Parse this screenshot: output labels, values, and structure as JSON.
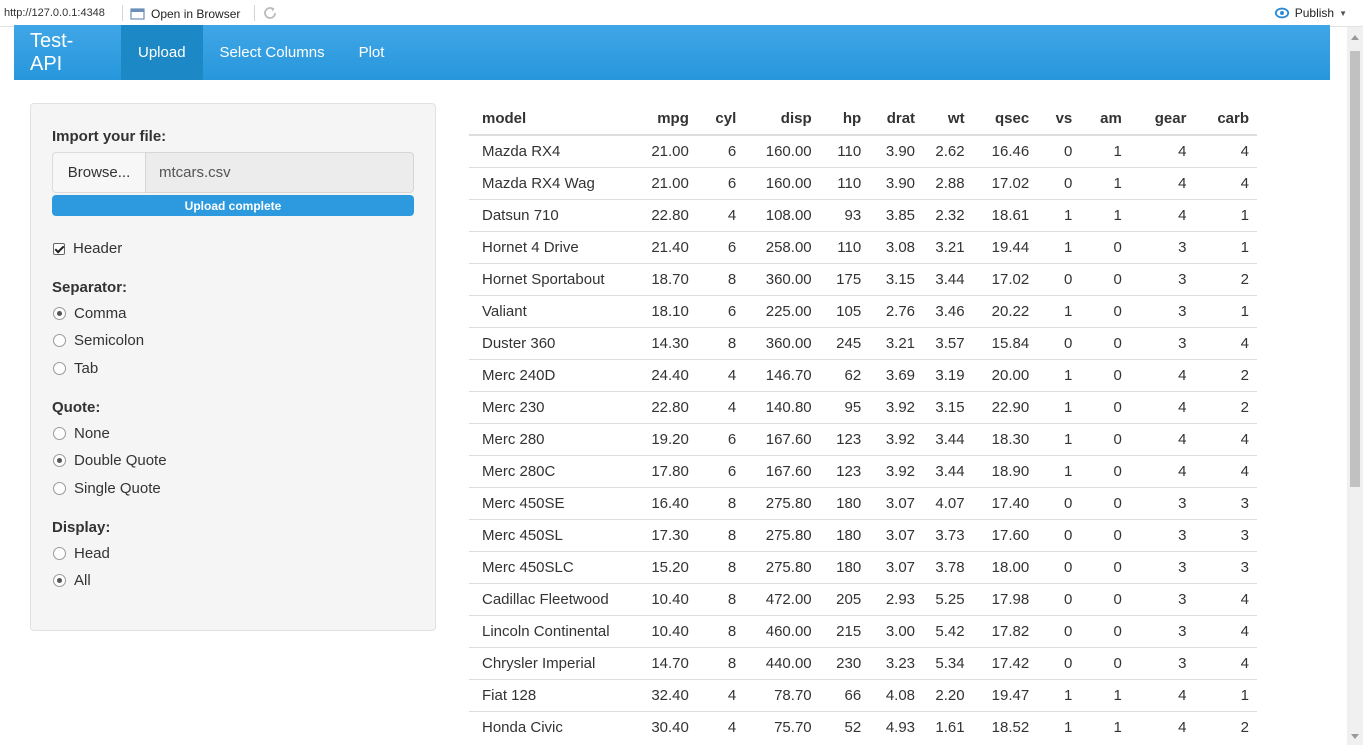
{
  "viewer": {
    "url": "http://127.0.0.1:4348",
    "open_in_browser": "Open in Browser",
    "publish": "Publish"
  },
  "navbar": {
    "brand": "Test-API",
    "tabs": [
      {
        "label": "Upload",
        "active": true
      },
      {
        "label": "Select Columns",
        "active": false
      },
      {
        "label": "Plot",
        "active": false
      }
    ]
  },
  "sidebar": {
    "import_label": "Import your file:",
    "browse_label": "Browse...",
    "file_name": "mtcars.csv",
    "progress_text": "Upload complete",
    "progress": 1.0,
    "header_label": "Header",
    "header_checked": true,
    "separator_label": "Separator:",
    "separator_options": [
      "Comma",
      "Semicolon",
      "Tab"
    ],
    "separator_selected": "Comma",
    "quote_label": "Quote:",
    "quote_options": [
      "None",
      "Double Quote",
      "Single Quote"
    ],
    "quote_selected": "Double Quote",
    "display_label": "Display:",
    "display_options": [
      "Head",
      "All"
    ],
    "display_selected": "All"
  },
  "table": {
    "columns": [
      "model",
      "mpg",
      "cyl",
      "disp",
      "hp",
      "drat",
      "wt",
      "qsec",
      "vs",
      "am",
      "gear",
      "carb"
    ],
    "rows": [
      [
        "Mazda RX4",
        "21.00",
        "6",
        "160.00",
        "110",
        "3.90",
        "2.62",
        "16.46",
        "0",
        "1",
        "4",
        "4"
      ],
      [
        "Mazda RX4 Wag",
        "21.00",
        "6",
        "160.00",
        "110",
        "3.90",
        "2.88",
        "17.02",
        "0",
        "1",
        "4",
        "4"
      ],
      [
        "Datsun 710",
        "22.80",
        "4",
        "108.00",
        "93",
        "3.85",
        "2.32",
        "18.61",
        "1",
        "1",
        "4",
        "1"
      ],
      [
        "Hornet 4 Drive",
        "21.40",
        "6",
        "258.00",
        "110",
        "3.08",
        "3.21",
        "19.44",
        "1",
        "0",
        "3",
        "1"
      ],
      [
        "Hornet Sportabout",
        "18.70",
        "8",
        "360.00",
        "175",
        "3.15",
        "3.44",
        "17.02",
        "0",
        "0",
        "3",
        "2"
      ],
      [
        "Valiant",
        "18.10",
        "6",
        "225.00",
        "105",
        "2.76",
        "3.46",
        "20.22",
        "1",
        "0",
        "3",
        "1"
      ],
      [
        "Duster 360",
        "14.30",
        "8",
        "360.00",
        "245",
        "3.21",
        "3.57",
        "15.84",
        "0",
        "0",
        "3",
        "4"
      ],
      [
        "Merc 240D",
        "24.40",
        "4",
        "146.70",
        "62",
        "3.69",
        "3.19",
        "20.00",
        "1",
        "0",
        "4",
        "2"
      ],
      [
        "Merc 230",
        "22.80",
        "4",
        "140.80",
        "95",
        "3.92",
        "3.15",
        "22.90",
        "1",
        "0",
        "4",
        "2"
      ],
      [
        "Merc 280",
        "19.20",
        "6",
        "167.60",
        "123",
        "3.92",
        "3.44",
        "18.30",
        "1",
        "0",
        "4",
        "4"
      ],
      [
        "Merc 280C",
        "17.80",
        "6",
        "167.60",
        "123",
        "3.92",
        "3.44",
        "18.90",
        "1",
        "0",
        "4",
        "4"
      ],
      [
        "Merc 450SE",
        "16.40",
        "8",
        "275.80",
        "180",
        "3.07",
        "4.07",
        "17.40",
        "0",
        "0",
        "3",
        "3"
      ],
      [
        "Merc 450SL",
        "17.30",
        "8",
        "275.80",
        "180",
        "3.07",
        "3.73",
        "17.60",
        "0",
        "0",
        "3",
        "3"
      ],
      [
        "Merc 450SLC",
        "15.20",
        "8",
        "275.80",
        "180",
        "3.07",
        "3.78",
        "18.00",
        "0",
        "0",
        "3",
        "3"
      ],
      [
        "Cadillac Fleetwood",
        "10.40",
        "8",
        "472.00",
        "205",
        "2.93",
        "5.25",
        "17.98",
        "0",
        "0",
        "3",
        "4"
      ],
      [
        "Lincoln Continental",
        "10.40",
        "8",
        "460.00",
        "215",
        "3.00",
        "5.42",
        "17.82",
        "0",
        "0",
        "3",
        "4"
      ],
      [
        "Chrysler Imperial",
        "14.70",
        "8",
        "440.00",
        "230",
        "3.23",
        "5.34",
        "17.42",
        "0",
        "0",
        "3",
        "4"
      ],
      [
        "Fiat 128",
        "32.40",
        "4",
        "78.70",
        "66",
        "4.08",
        "2.20",
        "19.47",
        "1",
        "1",
        "4",
        "1"
      ],
      [
        "Honda Civic",
        "30.40",
        "4",
        "75.70",
        "52",
        "4.93",
        "1.61",
        "18.52",
        "1",
        "1",
        "4",
        "2"
      ]
    ]
  }
}
